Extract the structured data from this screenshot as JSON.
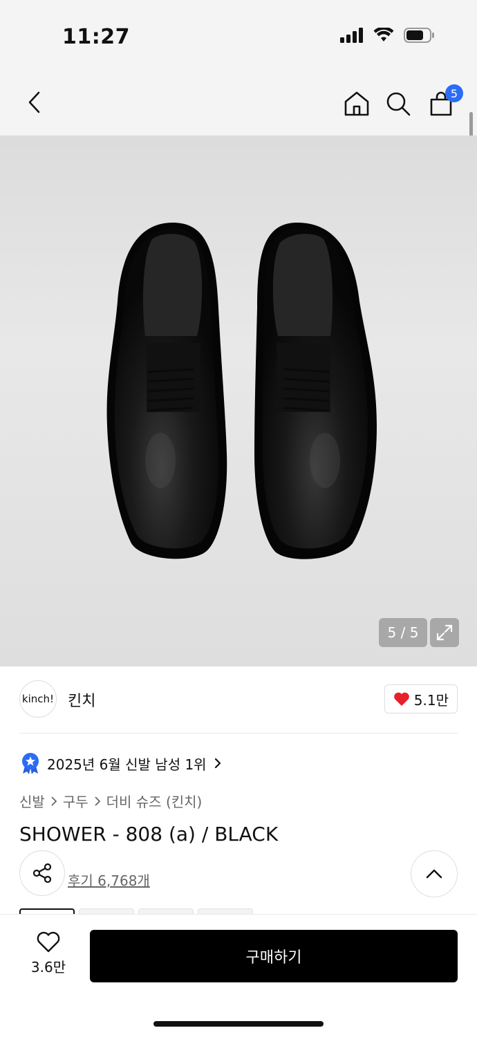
{
  "status_bar": {
    "time": "11:27"
  },
  "header": {
    "back_icon": "chevron-left-icon",
    "home_icon": "home-icon",
    "search_icon": "search-icon",
    "cart_icon": "shopping-bag-icon",
    "cart_count": "5",
    "badge_color": "#2b6cf6"
  },
  "gallery": {
    "counter": "5 / 5",
    "expand_icon": "expand-icon"
  },
  "brand": {
    "logo_text": "kinch!",
    "name": "킨치",
    "likes": "5.1만",
    "heart_color": "#e8202a"
  },
  "ranking": {
    "text": "2025년 6월 신발 남성 1위",
    "badge_icon": "award-star-icon"
  },
  "breadcrumb": {
    "items": [
      "신발",
      "구두",
      "더비 슈즈 (킨치)"
    ]
  },
  "product": {
    "title": "SHOWER - 808 (a) / BLACK",
    "reviews": "후기 6,768개"
  },
  "bottom_bar": {
    "wish_count": "3.6만",
    "buy_label": "구매하기"
  }
}
